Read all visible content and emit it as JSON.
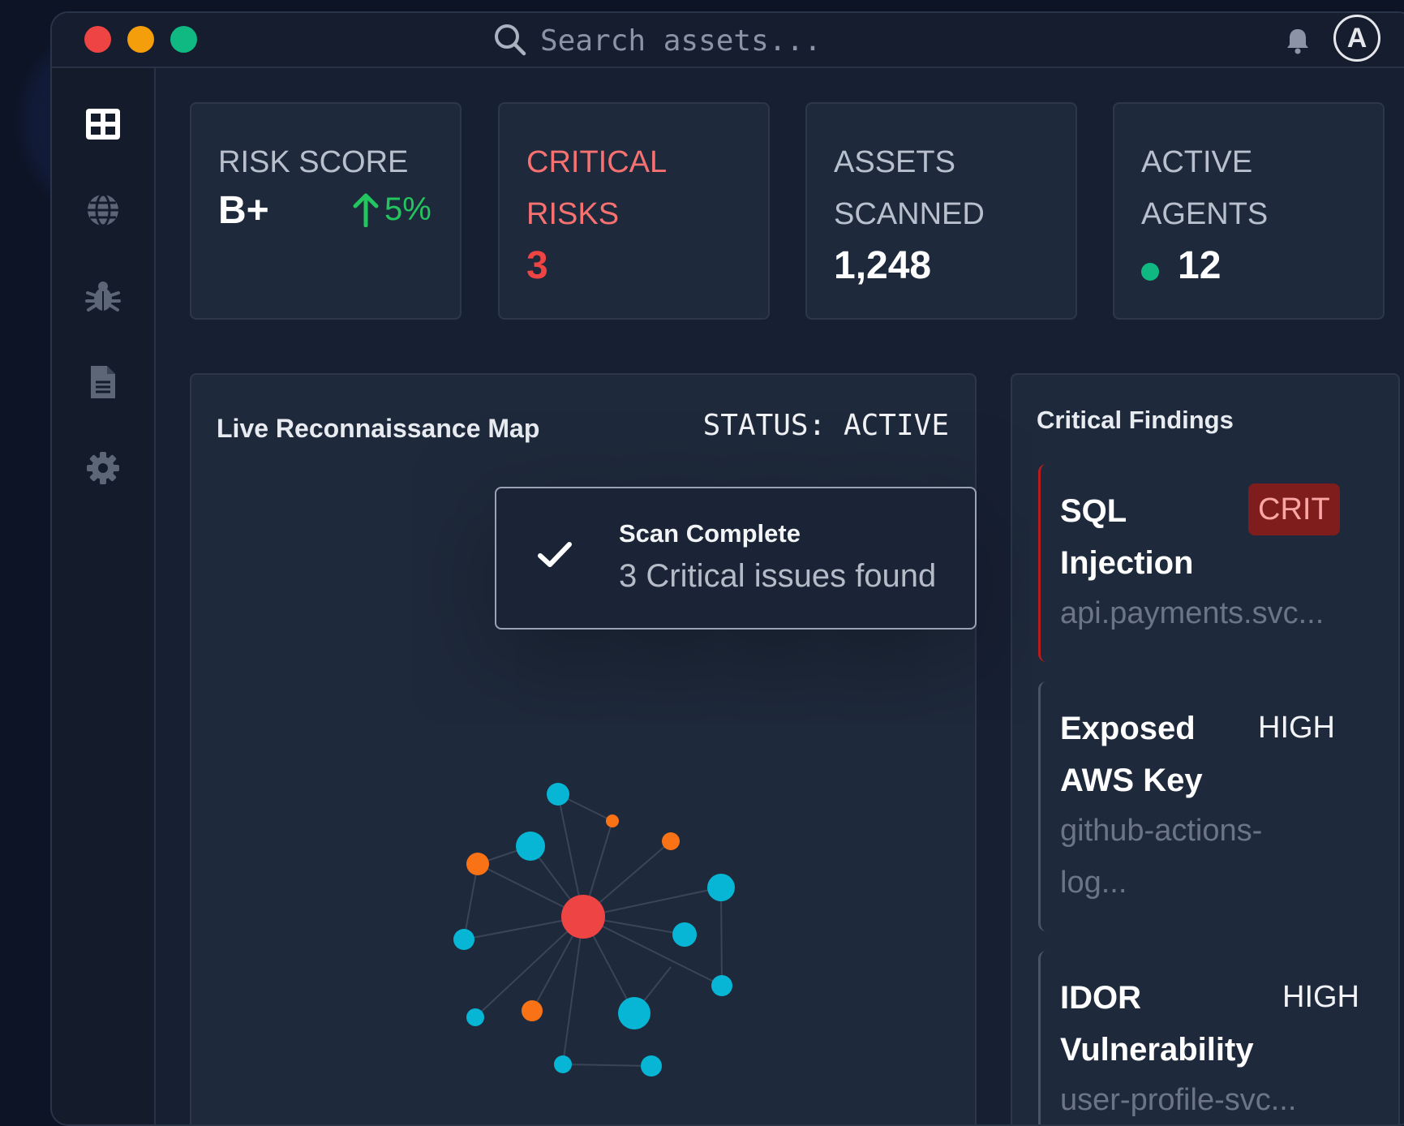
{
  "titlebar": {
    "search_placeholder": "Search assets...",
    "avatar_initial": "A"
  },
  "sidebar": {
    "items": [
      {
        "icon": "dashboard-grid-icon",
        "active": true
      },
      {
        "icon": "globe-icon",
        "active": false
      },
      {
        "icon": "bug-icon",
        "active": false
      },
      {
        "icon": "document-icon",
        "active": false
      },
      {
        "icon": "gear-icon",
        "active": false
      }
    ]
  },
  "stats": {
    "risk_score": {
      "label": "RISK SCORE",
      "value": "B+",
      "delta": "5%"
    },
    "critical_risks": {
      "label": "CRITICAL RISKS",
      "value": "3"
    },
    "assets_scanned": {
      "label": "ASSETS SCANNED",
      "value": "1,248"
    },
    "active_agents": {
      "label": "ACTIVE AGENTS",
      "value": "12"
    }
  },
  "map": {
    "title": "Live Reconnaissance Map",
    "status": "STATUS: ACTIVE"
  },
  "toast": {
    "title": "Scan Complete",
    "message": "3 Critical issues found"
  },
  "findings": {
    "title": "Critical Findings",
    "items": [
      {
        "name": "SQL Injection",
        "severity": "CRIT",
        "host": "api.payments.svc..."
      },
      {
        "name": "Exposed AWS Key",
        "severity": "HIGH",
        "host": "github-actions-log..."
      },
      {
        "name": "IDOR Vulnerability",
        "severity": "HIGH",
        "host": "user-profile-svc..."
      }
    ]
  },
  "colors": {
    "critical": "#ef4444",
    "success": "#22c55e",
    "node_cyan": "#06b6d4",
    "node_orange": "#f97316",
    "panel": "#1e293b"
  }
}
